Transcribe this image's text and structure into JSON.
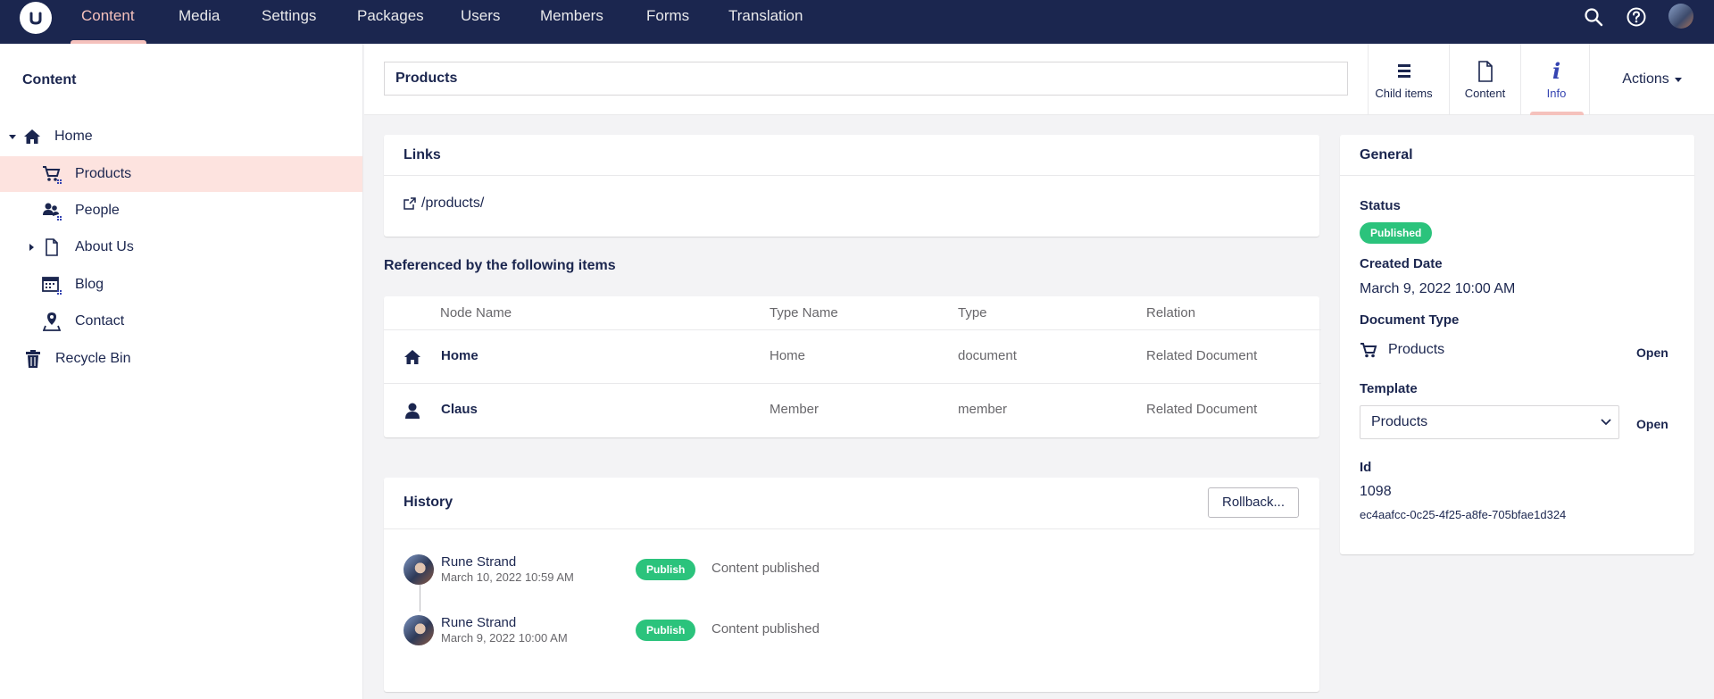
{
  "topnav": {
    "items": [
      "Content",
      "Media",
      "Settings",
      "Packages",
      "Users",
      "Members",
      "Forms",
      "Translation"
    ]
  },
  "sidebar": {
    "title": "Content",
    "tree": [
      {
        "label": "Home",
        "icon": "home-icon"
      },
      {
        "label": "Products",
        "icon": "cart-icon",
        "selected": true
      },
      {
        "label": "People",
        "icon": "people-icon"
      },
      {
        "label": "About Us",
        "icon": "document-icon"
      },
      {
        "label": "Blog",
        "icon": "calendar-icon"
      },
      {
        "label": "Contact",
        "icon": "map-pin-icon"
      },
      {
        "label": "Recycle Bin",
        "icon": "trash-icon"
      }
    ]
  },
  "header": {
    "name_value": "Products",
    "tabs": [
      "Child items",
      "Content",
      "Info"
    ],
    "active_tab": "Info",
    "actions_label": "Actions"
  },
  "links": {
    "title": "Links",
    "url": "/products/"
  },
  "references": {
    "title": "Referenced by the following items",
    "columns": [
      "Node Name",
      "Type Name",
      "Type",
      "Relation"
    ],
    "rows": [
      {
        "icon": "home-icon",
        "name": "Home",
        "type_name": "Home",
        "type": "document",
        "relation": "Related Document"
      },
      {
        "icon": "user-icon",
        "name": "Claus",
        "type_name": "Member",
        "type": "member",
        "relation": "Related Document"
      }
    ]
  },
  "history": {
    "title": "History",
    "rollback_label": "Rollback...",
    "items": [
      {
        "user": "Rune Strand",
        "date": "March 10, 2022 10:59 AM",
        "badge": "Publish",
        "text": "Content published"
      },
      {
        "user": "Rune Strand",
        "date": "March 9, 2022 10:00 AM",
        "badge": "Publish",
        "text": "Content published"
      }
    ]
  },
  "general": {
    "title": "General",
    "status_label": "Status",
    "status_value": "Published",
    "created_label": "Created Date",
    "created_value": "March 9, 2022 10:00 AM",
    "doctype_label": "Document Type",
    "doctype_value": "Products",
    "open_label": "Open",
    "template_label": "Template",
    "template_value": "Products",
    "id_label": "Id",
    "id_value": "1098",
    "guid": "ec4aafcc-0c25-4f25-a8fe-705bfae1d324"
  },
  "colors": {
    "topbar": "#1b264f",
    "accent": "#f5c1bc",
    "selected_bg": "#fde3df",
    "success": "#2bc37c",
    "active_tab": "#3544b1"
  }
}
